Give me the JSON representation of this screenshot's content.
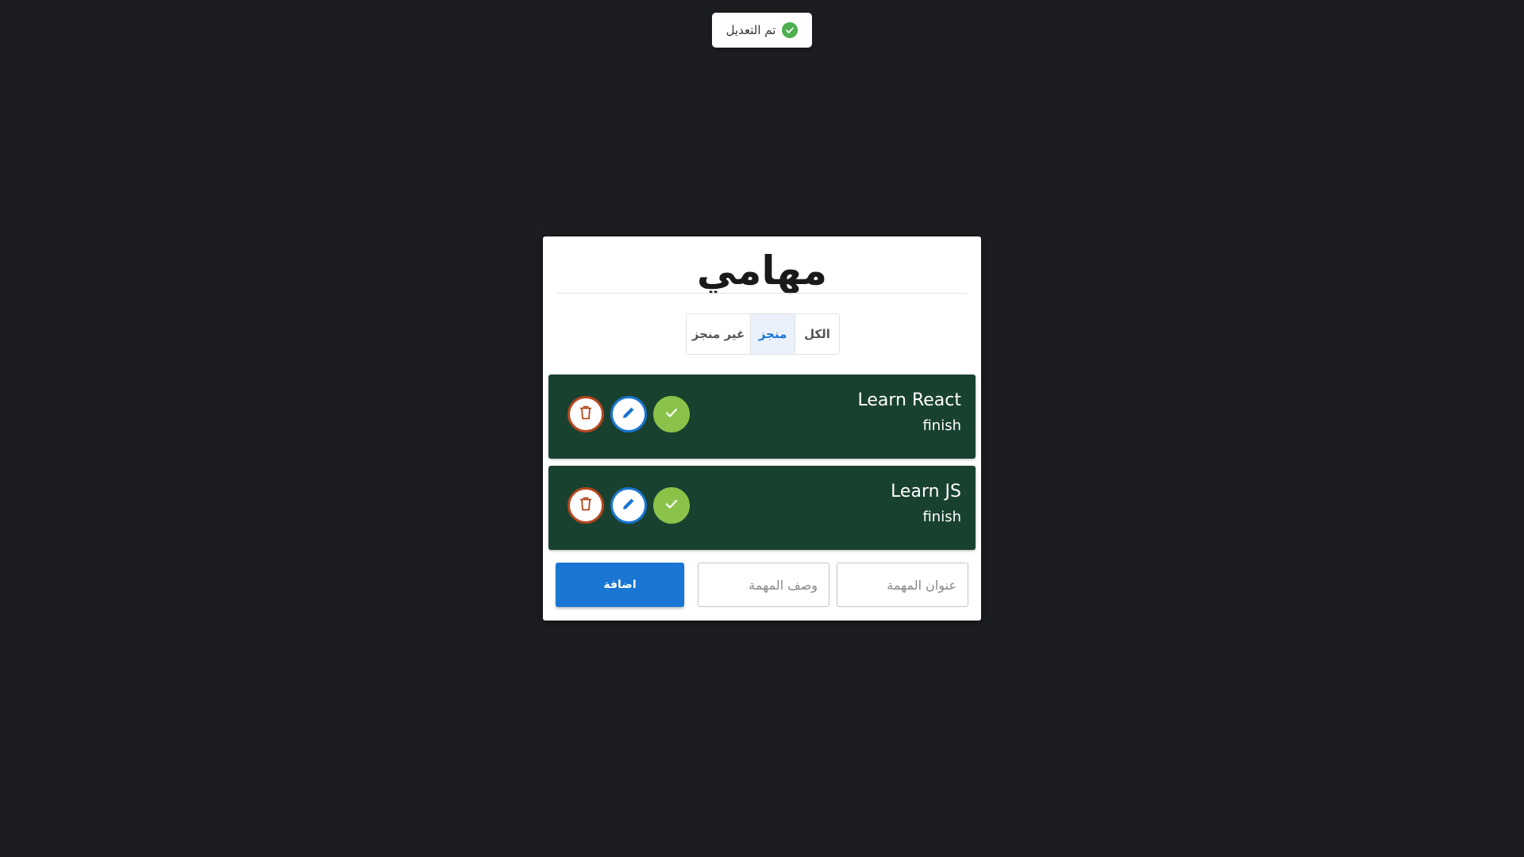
{
  "toast": {
    "text": "تم التعديل",
    "icon": "check-circle-icon",
    "color": "#4caf50"
  },
  "app": {
    "title": "مهامي"
  },
  "filters": {
    "all": "الكل",
    "done": "منجز",
    "not_done": "غير منجز",
    "selected": "done"
  },
  "todos": [
    {
      "title": "Learn React",
      "description": "finish",
      "completed": true
    },
    {
      "title": "Learn JS",
      "description": "finish",
      "completed": true
    }
  ],
  "form": {
    "title_placeholder": "عنوان المهمة",
    "description_placeholder": "وصف المهمة",
    "add_label": "اضافة"
  },
  "colors": {
    "background": "#1c1d21",
    "todo_bg": "#19412f",
    "accent": "#1976d2",
    "delete": "#b5471f",
    "check": "#8bc34a"
  }
}
